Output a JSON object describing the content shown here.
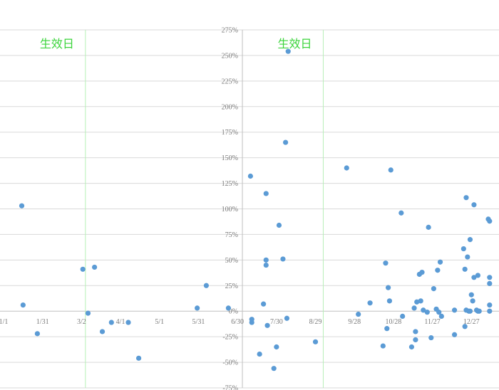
{
  "chart_data": {
    "type": "scatter",
    "title": "",
    "xlabel": "",
    "ylabel": "",
    "x_axis": {
      "tick_labels": [
        "1/1",
        "1/31",
        "3/2",
        "4/1",
        "5/1",
        "5/31",
        "6/30",
        "7/30",
        "8/29",
        "9/28",
        "10/28",
        "11/27",
        "12/27"
      ],
      "label_interval_days": 30,
      "range_days": [
        1,
        364
      ]
    },
    "y_axis": {
      "tick_labels": [
        "275%",
        "250%",
        "225%",
        "200%",
        "175%",
        "150%",
        "125%",
        "100%",
        "75%",
        "50%",
        "25%",
        "0%",
        "-25%",
        "-50%",
        "-75%"
      ],
      "ylim": [
        -0.75,
        2.75
      ],
      "major_unit": 0.25,
      "format": "percent"
    },
    "grid": {
      "horizontal": true,
      "color": "#d9d9d9"
    },
    "reference_lines": [
      {
        "label": "生效日",
        "day": 64,
        "color": "#3bd43b"
      },
      {
        "label": "生效日",
        "day": 247,
        "color": "#3bd43b"
      }
    ],
    "series": [
      {
        "color": "#5b9bd5",
        "points": [
          [
            15,
            1.03
          ],
          [
            16,
            0.06
          ],
          [
            27,
            -0.22
          ],
          [
            62,
            0.41
          ],
          [
            66,
            -0.02
          ],
          [
            71,
            0.43
          ],
          [
            77,
            -0.2
          ],
          [
            84,
            -0.11
          ],
          [
            97,
            -0.11
          ],
          [
            105,
            -0.46
          ],
          [
            150,
            0.03
          ],
          [
            157,
            0.25
          ],
          [
            174,
            0.03
          ],
          [
            191,
            1.32
          ],
          [
            192,
            -0.08
          ],
          [
            192,
            -0.11
          ],
          [
            198,
            -0.42
          ],
          [
            201,
            0.07
          ],
          [
            203,
            1.15
          ],
          [
            203,
            0.5
          ],
          [
            203,
            0.45
          ],
          [
            204,
            -0.14
          ],
          [
            209,
            -0.56
          ],
          [
            211,
            -0.35
          ],
          [
            213,
            0.84
          ],
          [
            216,
            0.51
          ],
          [
            218,
            1.65
          ],
          [
            219,
            -0.07
          ],
          [
            220,
            2.54
          ],
          [
            241,
            -0.3
          ],
          [
            265,
            1.4
          ],
          [
            274,
            -0.03
          ],
          [
            283,
            0.08
          ],
          [
            293,
            -0.34
          ],
          [
            295,
            0.47
          ],
          [
            296,
            -0.17
          ],
          [
            297,
            0.23
          ],
          [
            298,
            0.1
          ],
          [
            299,
            1.38
          ],
          [
            307,
            0.96
          ],
          [
            308,
            -0.05
          ],
          [
            315,
            -0.35
          ],
          [
            317,
            0.03
          ],
          [
            318,
            -0.28
          ],
          [
            318,
            -0.2
          ],
          [
            319,
            0.09
          ],
          [
            321,
            0.36
          ],
          [
            322,
            0.1
          ],
          [
            323,
            0.38
          ],
          [
            324,
            0.01
          ],
          [
            327,
            -0.01
          ],
          [
            328,
            0.82
          ],
          [
            330,
            -0.26
          ],
          [
            332,
            0.22
          ],
          [
            334,
            0.02
          ],
          [
            335,
            0.4
          ],
          [
            336,
            -0.01
          ],
          [
            337,
            0.48
          ],
          [
            338,
            -0.05
          ],
          [
            348,
            -0.23
          ],
          [
            348,
            0.01
          ],
          [
            355,
            0.61
          ],
          [
            356,
            0.41
          ],
          [
            356,
            -0.15
          ],
          [
            357,
            1.11
          ],
          [
            357,
            0.01
          ],
          [
            358,
            0.53
          ],
          [
            359,
            0.0
          ],
          [
            360,
            0.7
          ],
          [
            360,
            0.0
          ],
          [
            361,
            0.16
          ],
          [
            362,
            0.1
          ],
          [
            363,
            1.04
          ],
          [
            363,
            0.33
          ],
          [
            365,
            0.01
          ],
          [
            366,
            0.35
          ],
          [
            366,
            0.0
          ],
          [
            367,
            0.0
          ],
          [
            374,
            0.9
          ],
          [
            375,
            0.88
          ],
          [
            375,
            0.33
          ],
          [
            375,
            0.27
          ],
          [
            375,
            0.06
          ],
          [
            375,
            0.0
          ]
        ]
      }
    ]
  }
}
